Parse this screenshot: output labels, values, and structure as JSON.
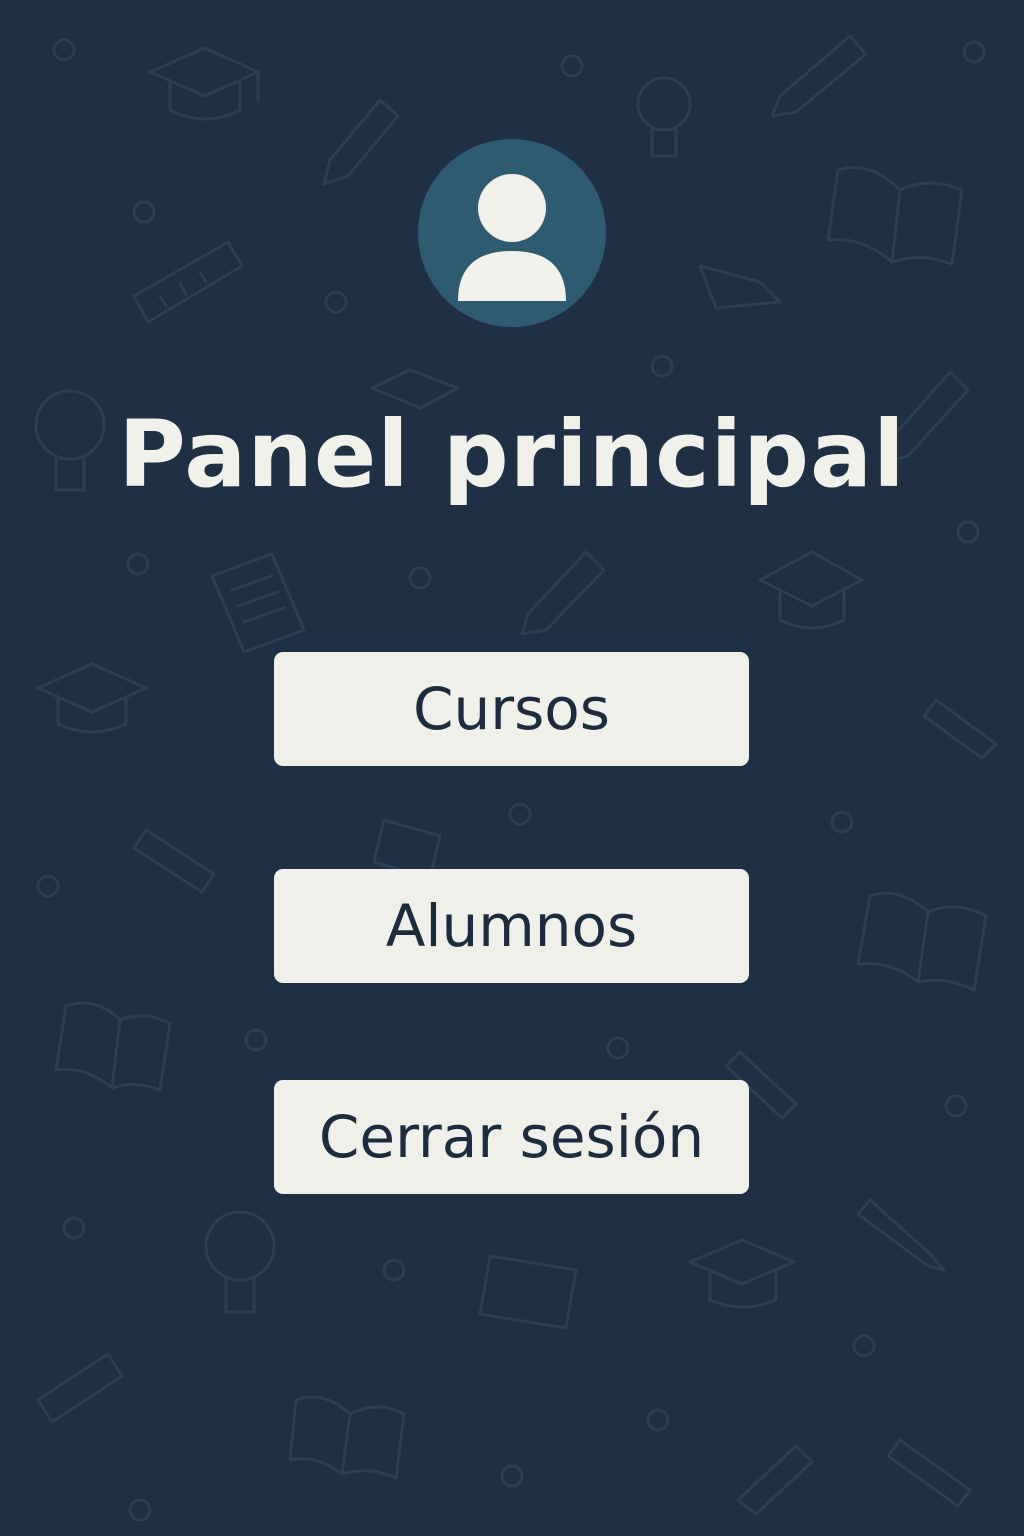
{
  "app": {
    "title": "Panel principal"
  },
  "avatar": {
    "icon": "user-avatar-icon",
    "background_color": "#2f5b71",
    "figure_color": "#f1f1ec"
  },
  "menu": {
    "buttons": [
      {
        "label": "Cursos"
      },
      {
        "label": "Alumnos"
      },
      {
        "label": "Cerrar sesión"
      }
    ]
  },
  "colors": {
    "background": "#1f3044",
    "pattern": "#2b3f55",
    "button_background": "#f0f0eb",
    "button_text": "#1d2c3d",
    "title_text": "#f1f1ec"
  },
  "background_pattern": {
    "icons": [
      "graduation-cap-icon",
      "pencil-icon",
      "book-icon",
      "lightbulb-icon",
      "ruler-icon",
      "document-icon",
      "circle-dot-icon"
    ]
  }
}
